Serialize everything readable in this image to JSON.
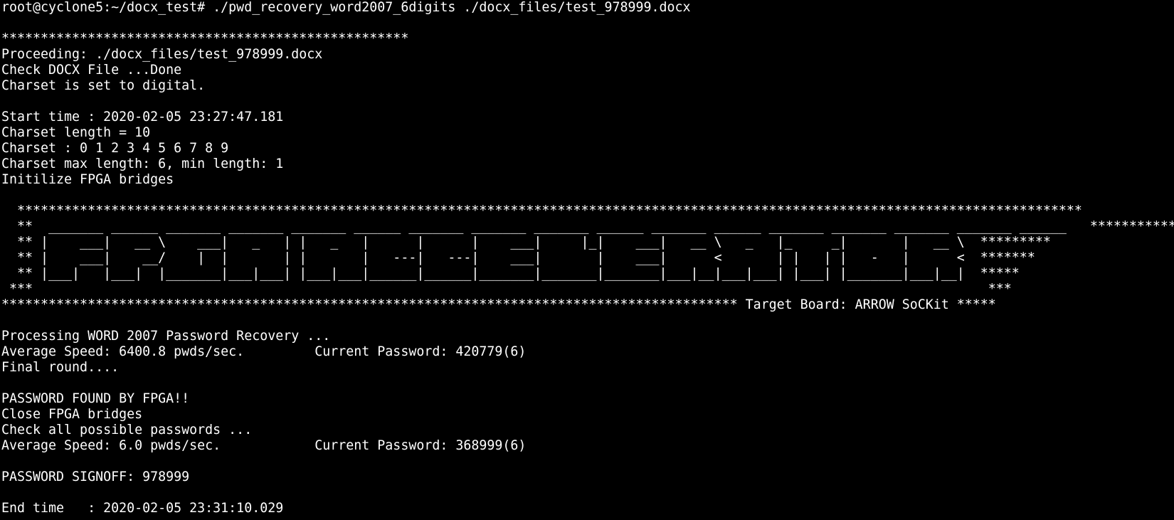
{
  "terminal": {
    "background": "#000000",
    "foreground": "#ffffff",
    "lines": [
      "root@cyclone5:~/docx_test# ./pwd_recovery_word2007_6digits ./docx_files/test_978999.docx",
      "",
      "****************************************************",
      "Proceeding: ./docx_files/test_978999.docx",
      "Check DOCX File ...Done",
      "Charset is set to digital.",
      "",
      "Start time : 2020-02-05 23:27:47.181",
      "Charset length = 10",
      "Charset : 0 1 2 3 4 5 6 7 8 9",
      "Charset max length: 6, min length: 1",
      "Initilize FPGA bridges",
      "",
      "  ****************************************************************************************************************************************",
      "  **  _______ ______ _______ _______ _______ ______ _______ _______ _______ ______ _______ ______ _______ _______ _______ _______ ______   ***********",
      "  ** |    ___|   __ \\    ___|   _   | |   _   |      |      |    ___|     |_|    ___|   __ \\   _   |_     _|       |   __ \\  *********",
      "  ** |    ___|    __/    |  |       | |       |   ---|   ---|    ___|       |    ___|      <       | |   | |   -   |      <  *******",
      "  ** |___|   |___|  |_______|___|___| |___|___|______|______|_______|_______|_______|___|__|___|___| |___| |_______|___|__|  *****",
      " ***                                                                                                                          ***",
      "********************************************************************************************** Target Board: ARROW SoCKit *****",
      "",
      "Processing WORD 2007 Password Recovery ...",
      "Average Speed: 6400.8 pwds/sec.         Current Password: 420779(6)",
      "Final round....",
      "",
      "PASSWORD FOUND BY FPGA!!",
      "Close FPGA bridges",
      "Check all possible passwords ...",
      "Average Speed: 6.0 pwds/sec.            Current Password: 368999(6)",
      "",
      "PASSWORD SIGNOFF: 978999",
      "",
      "End time   : 2020-02-05 23:31:10.029"
    ]
  }
}
